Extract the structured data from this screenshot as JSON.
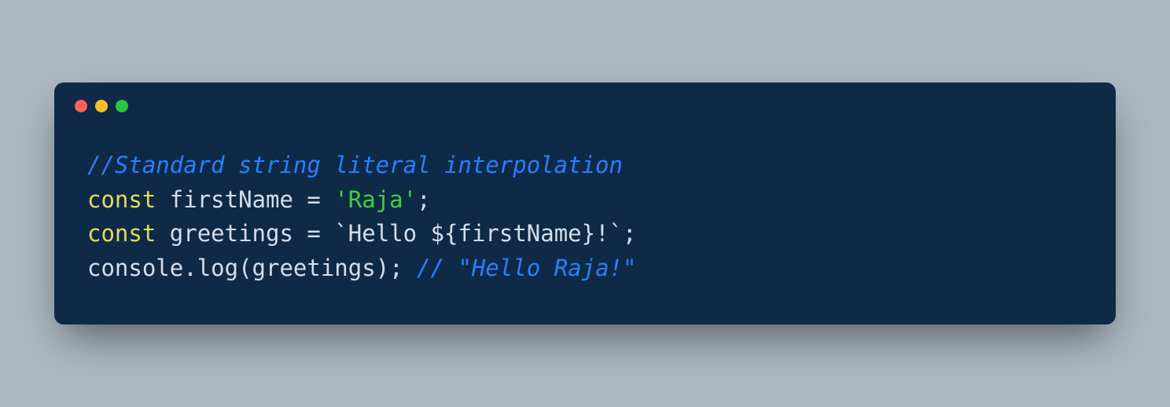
{
  "window": {
    "traffic_lights": {
      "red": "#ff5f56",
      "yellow": "#ffbd2e",
      "green": "#27c93f"
    }
  },
  "colors": {
    "background": "#abb8c3",
    "editor_bg": "#0e2a47",
    "comment": "#2a7fff",
    "keyword": "#e6db5d",
    "string": "#3fd13f",
    "default": "#d6deeb"
  },
  "code": {
    "line1": {
      "comment": "//Standard string literal interpolation"
    },
    "line2": {
      "keyword": "const",
      "space1": " ",
      "variable": "firstName",
      "space2": " ",
      "operator": "=",
      "space3": " ",
      "quote_open": "'",
      "string": "Raja",
      "quote_close": "'",
      "semicolon": ";"
    },
    "line3": {
      "keyword": "const",
      "space1": " ",
      "variable": "greetings",
      "space2": " ",
      "operator": "=",
      "space3": " ",
      "backtick_open": "`",
      "template_str1": "Hello ",
      "interp_open": "${",
      "interp_var": "firstName",
      "interp_close": "}",
      "template_str2": "!",
      "backtick_close": "`",
      "semicolon": ";"
    },
    "line4": {
      "object": "console",
      "dot": ".",
      "method": "log",
      "paren_open": "(",
      "arg": "greetings",
      "paren_close": ")",
      "semicolon": ";",
      "space": " ",
      "comment": "// \"Hello Raja!\""
    }
  }
}
